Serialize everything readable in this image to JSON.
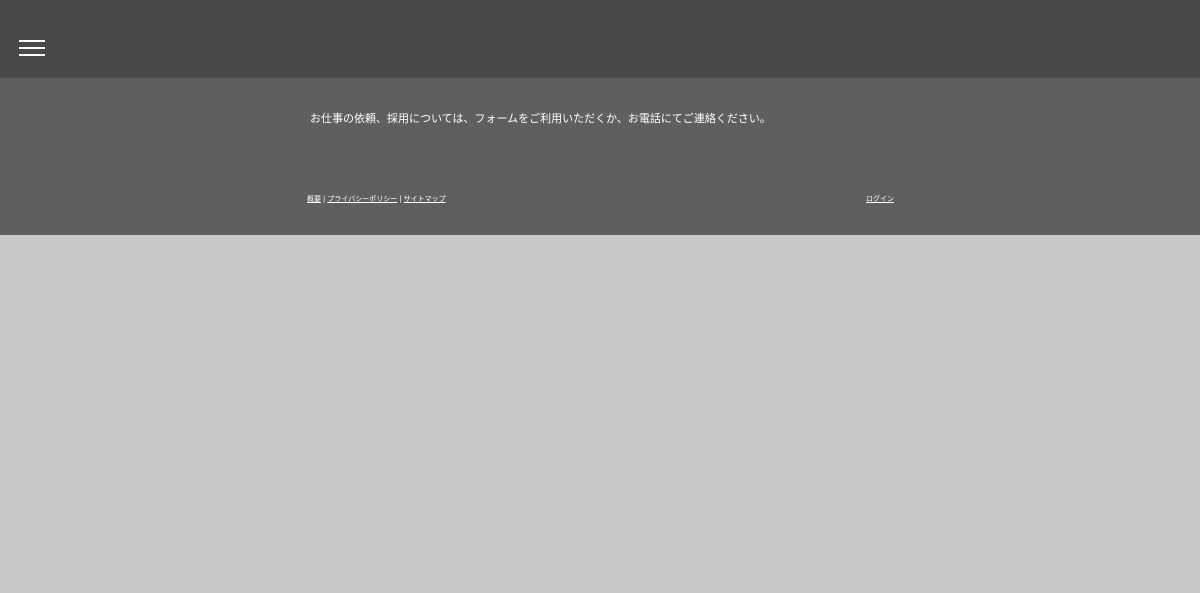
{
  "header": {
    "menu_icon": "hamburger-menu-icon"
  },
  "footer": {
    "contact_text": "お仕事の依頼、採用については、フォームをご利用いただくか、お電話にてご連絡ください。",
    "links": [
      {
        "label": "概要"
      },
      {
        "label": "プライバシーポリシー"
      },
      {
        "label": "サイトマップ"
      }
    ],
    "separator": "|",
    "login_label": "ログイン"
  },
  "colors": {
    "topbar": "#484848",
    "footer": "#5f5f5f",
    "page_background": "#c8c8c8",
    "text": "#ffffff"
  }
}
